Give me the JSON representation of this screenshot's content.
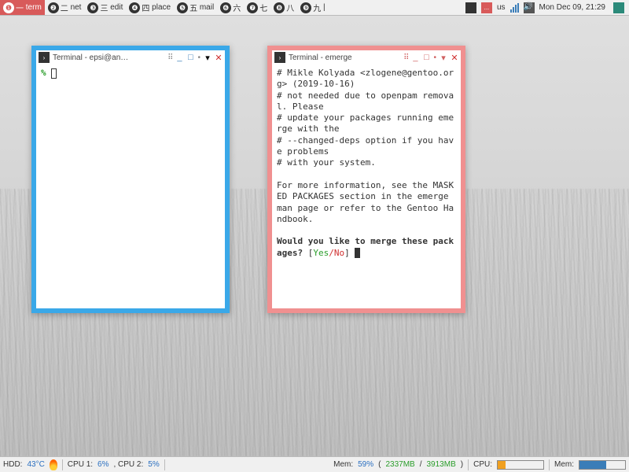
{
  "top_panel": {
    "workspaces": [
      {
        "num": "❶",
        "glyph": "一",
        "label": "term",
        "active": true
      },
      {
        "num": "❷",
        "glyph": "二",
        "label": "net"
      },
      {
        "num": "❸",
        "glyph": "三",
        "label": "edit"
      },
      {
        "num": "❹",
        "glyph": "四",
        "label": "place"
      },
      {
        "num": "❺",
        "glyph": "五",
        "label": "mail"
      },
      {
        "num": "❻",
        "glyph": "六",
        "label": ""
      },
      {
        "num": "❼",
        "glyph": "七",
        "label": ""
      },
      {
        "num": "❽",
        "glyph": "八",
        "label": ""
      },
      {
        "num": "❾",
        "glyph": "九",
        "label": ""
      }
    ],
    "tray_dots": "...",
    "kbd": "us",
    "clock": "Mon Dec 09, 21:29"
  },
  "term_left": {
    "title": "Terminal - epsi@an…",
    "prompt": "%"
  },
  "term_right": {
    "title": "Terminal - emerge",
    "lines": [
      "# Mikle Kolyada <zlogene@gentoo.org> (2019-10-16)",
      "# not needed due to openpam removal. Please",
      "# update your packages running emerge with the",
      "# --changed-deps option if you have problems",
      "# with your system.",
      "",
      "For more information, see the MASKED PACKAGES section in the emerge",
      "man page or refer to the Gentoo Handbook.",
      ""
    ],
    "prompt_q": "Would you like to merge these packages?",
    "yes": "Yes",
    "no": "No"
  },
  "bottom": {
    "hdd_label": "HDD:",
    "hdd_temp": "43°C",
    "cpu_label": "CPU 1:",
    "cpu1": "6%",
    "cpu2_label": ", CPU 2:",
    "cpu2": "5%",
    "mem_label": "Mem:",
    "mem_pct": "59%",
    "mem_detail_a": "2337MB",
    "mem_detail_b": "3913MB",
    "cpu_bar_label": "CPU:",
    "cpu_bar_fill": 18,
    "mem_bar_label": "Mem:",
    "mem_bar_fill": 59
  }
}
